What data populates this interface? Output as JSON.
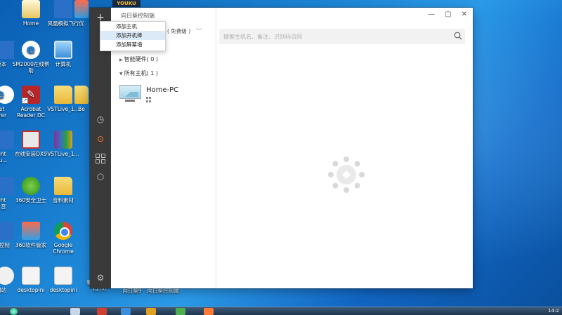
{
  "top_strip": {
    "label": "YOUKU"
  },
  "desktop": {
    "icons": [
      {
        "label": "Home"
      },
      {
        "label": "凤凰模拟飞行"
      },
      {
        "label": "优"
      },
      {
        "label": "SM2000在线帮助"
      },
      {
        "label": "计算机"
      },
      {
        "label": "Acrobat Reader DC"
      },
      {
        "label": "VSTLive_1..."
      },
      {
        "label": "Be"
      },
      {
        "label": "在线安装DX9"
      },
      {
        "label": "VSTLive_1..."
      },
      {
        "label": "360安全卫士"
      },
      {
        "label": "音料素材"
      },
      {
        "label": "360软件管家"
      },
      {
        "label": "Google Chrome"
      },
      {
        "label": "desktopini"
      },
      {
        "label": "desktopini"
      },
      {
        "label": "新建文本文档.txt"
      },
      {
        "label": "向日葵9"
      },
      {
        "label": "向日葵控制端"
      }
    ],
    "cut_icons": [
      {
        "label": "版本"
      },
      {
        "label": "net orer"
      },
      {
        "label": "ight au..."
      },
      {
        "label": "ight 7 音"
      },
      {
        "label": "0控制"
      },
      {
        "label": "回站"
      }
    ]
  },
  "app": {
    "title": "向日葵控制端",
    "edition": "( 免费级 )",
    "search_placeholder": "搜索主机名、备注、识别码访问",
    "groups": [
      {
        "label": "智能硬件( 0 )"
      },
      {
        "label": "所有主机( 1 )"
      }
    ],
    "host": {
      "name": "Home-PC"
    },
    "menu": {
      "items": [
        {
          "label": "添加主机"
        },
        {
          "label": "添加开机棒"
        },
        {
          "label": "添加屏幕墙"
        }
      ]
    }
  },
  "taskbar": {
    "clock": "14:2"
  },
  "colors": {
    "accent": "#ff7a33",
    "rail": "#3a3a3a",
    "menu_hover": "#dceaf8"
  }
}
